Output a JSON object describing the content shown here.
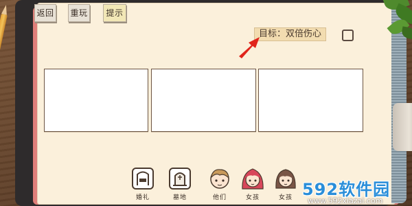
{
  "top_bar": {
    "back_label": "返回",
    "replay_label": "重玩",
    "hint_label": "提示"
  },
  "goal": {
    "text": "目标：双倍伤心",
    "completed": false
  },
  "cards": [
    {
      "content": ""
    },
    {
      "content": ""
    },
    {
      "content": ""
    }
  ],
  "bottom_items": [
    {
      "label": "婚礼",
      "icon": "wedding-altar-icon"
    },
    {
      "label": "墓地",
      "icon": "tombstone-icon"
    },
    {
      "label": "他们",
      "icon": "boy-character-icon"
    },
    {
      "label": "女孩",
      "icon": "red-hair-girl-icon"
    },
    {
      "label": "女孩",
      "icon": "brown-hair-girl-icon"
    }
  ],
  "watermark": {
    "main": "592软件园",
    "url": "www.592xiazai.com"
  },
  "colors": {
    "page": "#fbf0db",
    "goal_bg": "#f2dcb0",
    "arrow": "#e0241b",
    "watermark": "#2a8ed9"
  }
}
